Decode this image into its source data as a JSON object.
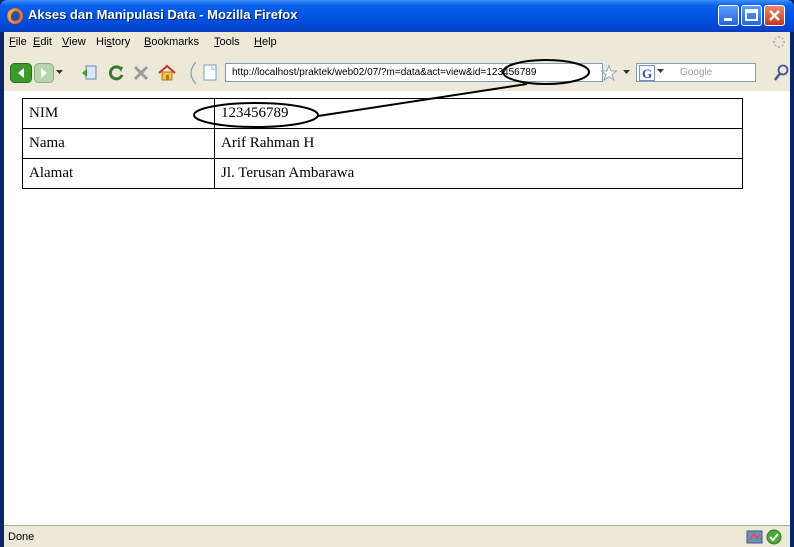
{
  "window": {
    "title": "Akses dan Manipulasi Data - Mozilla Firefox"
  },
  "menu": {
    "items": [
      {
        "prefix": "",
        "mnemonic": "F",
        "rest": "ile"
      },
      {
        "prefix": "",
        "mnemonic": "E",
        "rest": "dit"
      },
      {
        "prefix": "",
        "mnemonic": "V",
        "rest": "iew"
      },
      {
        "prefix": "Hi",
        "mnemonic": "s",
        "rest": "tory"
      },
      {
        "prefix": "",
        "mnemonic": "B",
        "rest": "ookmarks"
      },
      {
        "prefix": "",
        "mnemonic": "T",
        "rest": "ools"
      },
      {
        "prefix": "",
        "mnemonic": "H",
        "rest": "elp"
      }
    ]
  },
  "toolbar": {
    "url": "http://localhost/praktek/web02/07/?m=data&act=view&id=123456789",
    "search_placeholder": "Google"
  },
  "table": {
    "rows": [
      {
        "label": "NIM",
        "value": "123456789"
      },
      {
        "label": "Nama",
        "value": "Arif Rahman H"
      },
      {
        "label": "Alamat",
        "value": "Jl. Terusan Ambarawa"
      }
    ]
  },
  "status": {
    "text": "Done"
  },
  "icons": {
    "app": "firefox-icon",
    "back": "back-arrow-icon",
    "forward": "forward-arrow-icon",
    "reload": "reload-icon",
    "stop": "stop-icon",
    "home": "home-icon",
    "bookmark_star": "star-icon",
    "search_engine": "google-icon",
    "search": "magnifier-icon"
  },
  "colors": {
    "titlebar": "#0054e3",
    "chrome": "#ece9d8",
    "close_button": "#c4391b"
  }
}
